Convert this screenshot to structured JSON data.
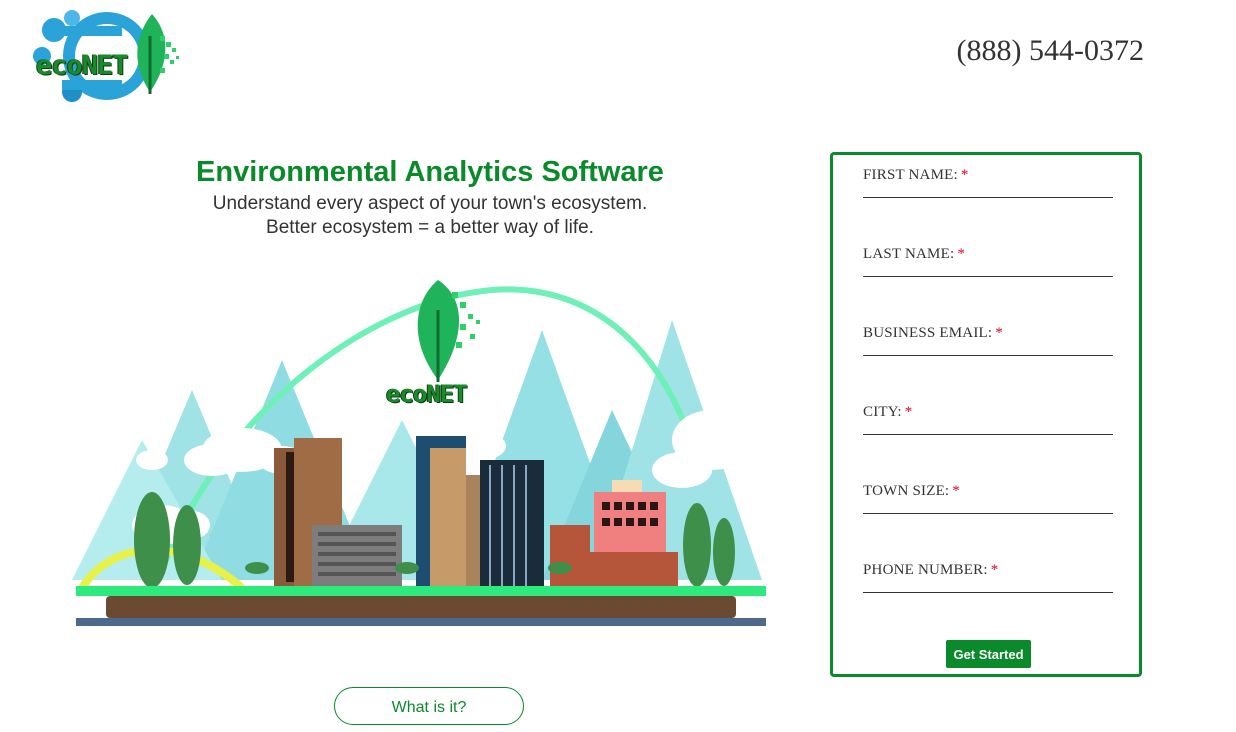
{
  "header": {
    "logo_text": "ecoNET",
    "phone": "(888) 544-0372"
  },
  "hero": {
    "title": "Environmental Analytics Software",
    "subtitle_line1": "Understand every aspect of your town's ecosystem.",
    "subtitle_line2": "Better ecosystem = a better way of life.",
    "illustration_logo_text": "ecoNET",
    "what_button": "What is it?"
  },
  "form": {
    "fields": [
      {
        "label": "FIRST NAME:",
        "required": "*"
      },
      {
        "label": "LAST NAME:",
        "required": "*"
      },
      {
        "label": "BUSINESS EMAIL:",
        "required": "*"
      },
      {
        "label": "CITY:",
        "required": "*"
      },
      {
        "label": "TOWN SIZE:",
        "required": "*"
      },
      {
        "label": "PHONE NUMBER:",
        "required": "*"
      }
    ],
    "submit_label": "Get Started"
  },
  "colors": {
    "brand_green": "#0b8a2b",
    "required_red": "#e0002a"
  }
}
